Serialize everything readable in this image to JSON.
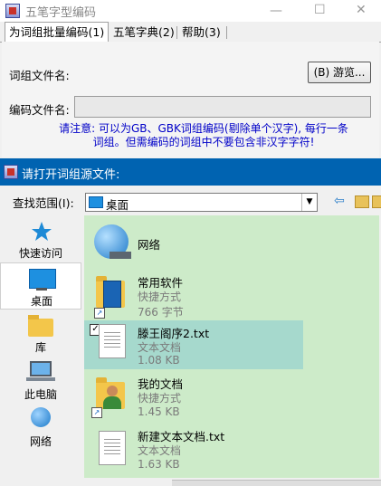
{
  "back_window": {
    "title": "五笔字型编码",
    "controls": {
      "minimize": "—",
      "maximize": "☐",
      "close": "✕"
    },
    "tabs": [
      {
        "label": "为词组批量编码(1)",
        "active": true
      },
      {
        "label": "五笔字典(2)",
        "active": false
      },
      {
        "label": "帮助(3)",
        "active": false
      }
    ],
    "phrase_file_label": "词组文件名:",
    "browse_button": "(B) 游览...",
    "code_file_label": "编码文件名:",
    "code_file_value": "",
    "note": "请注意: 可以为GB、GBK词组编码(剔除单个汉字), 每行一条词组。但需编码的词组中不要包含非汉字字符!"
  },
  "dialog": {
    "title": "请打开词组源文件:",
    "look_in_label": "查找范围(I):",
    "look_in_value": "桌面",
    "toolbar": {
      "back_icon": "⇦",
      "folder_icon": "📁"
    },
    "places": [
      {
        "label": "快速访问",
        "icon": "star-icon",
        "selected": false
      },
      {
        "label": "桌面",
        "icon": "desktop-icon",
        "selected": true
      },
      {
        "label": "库",
        "icon": "library-icon",
        "selected": false
      },
      {
        "label": "此电脑",
        "icon": "computer-icon",
        "selected": false
      },
      {
        "label": "网络",
        "icon": "network-icon",
        "selected": false
      }
    ],
    "files": [
      {
        "name": "网络",
        "kind": "network"
      },
      {
        "name": "常用软件",
        "type": "快捷方式",
        "size": "766 字节",
        "kind": "shortcut-folder"
      },
      {
        "name": "滕王阁序2.txt",
        "type": "文本文档",
        "size": "1.08 KB",
        "kind": "text",
        "selected": true,
        "checked": true
      },
      {
        "name": "我的文档",
        "type": "快捷方式",
        "size": "1.45 KB",
        "kind": "shortcut-user"
      },
      {
        "name": "新建文本文档.txt",
        "type": "文本文档",
        "size": "1.63 KB",
        "kind": "text"
      }
    ]
  },
  "colors": {
    "dialog_title_bg": "#0063b1",
    "file_list_bg": "#cdebc9",
    "selected_item_bg": "#a6d9cd",
    "note_text": "#0000c8"
  }
}
